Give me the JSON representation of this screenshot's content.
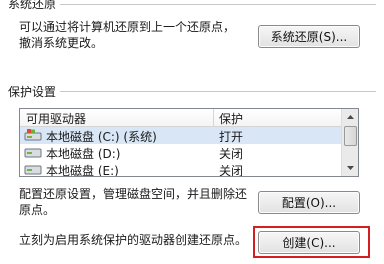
{
  "system_restore": {
    "section_label": "系统还原",
    "desc_line1": "可以通过将计算机还原到上一个还原点，",
    "desc_line2": "撤消系统更改。",
    "button_label": "系统还原(S)..."
  },
  "protection": {
    "section_label": "保护设置",
    "columns": [
      "可用驱动器",
      "保护"
    ],
    "drives": [
      {
        "name": "本地磁盘 (C:) (系统)",
        "status": "打开",
        "icon": "system-drive-icon"
      },
      {
        "name": "本地磁盘 (D:)",
        "status": "关闭",
        "icon": "drive-icon"
      },
      {
        "name": "本地磁盘 (E:)",
        "status": "关闭",
        "icon": "drive-icon"
      }
    ],
    "configure_desc_line1": "配置还原设置，管理磁盘空间，并且删除还",
    "configure_desc_line2": "原点。",
    "configure_button": "配置(O)...",
    "create_desc": "立刻为启用系统保护的驱动器创建还原点。",
    "create_button": "创建(C)..."
  },
  "colors": {
    "highlight": "#d21f1f",
    "selected_row": "#d8e6f6"
  }
}
